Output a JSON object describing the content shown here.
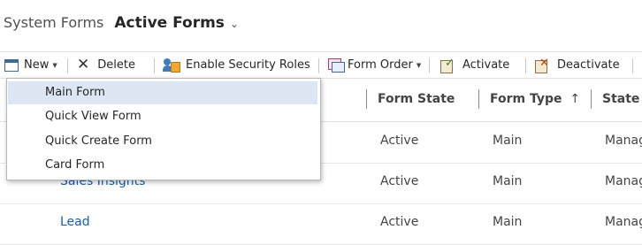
{
  "header": {
    "system_label": "System Forms",
    "view_label": "Active Forms",
    "view_chevron_icon": "chevron-down-icon"
  },
  "toolbar": {
    "new_label": "New",
    "delete_label": "Delete",
    "enable_security_roles_label": "Enable Security Roles",
    "form_order_label": "Form Order",
    "activate_label": "Activate",
    "deactivate_label": "Deactivate"
  },
  "columns": {
    "form_state": "Form State",
    "form_type": "Form Type",
    "form_type_sort_icon": "arrow-up-icon",
    "state": "State"
  },
  "rows": [
    {
      "name": "",
      "form_state": "Active",
      "form_type": "Main",
      "state": "Manag"
    },
    {
      "name": "Sales Insights",
      "form_state": "Active",
      "form_type": "Main",
      "state": "Manag"
    },
    {
      "name": "Lead",
      "form_state": "Active",
      "form_type": "Main",
      "state": "Manag"
    }
  ],
  "new_menu": {
    "items": [
      "Main Form",
      "Quick View Form",
      "Quick Create Form",
      "Card Form"
    ],
    "selected": "Main Form"
  },
  "colors": {
    "link": "#1160b7",
    "menu_highlight": "#dde6f3",
    "delete_icon": "#333333",
    "deactivate_icon": "#d83b01"
  }
}
